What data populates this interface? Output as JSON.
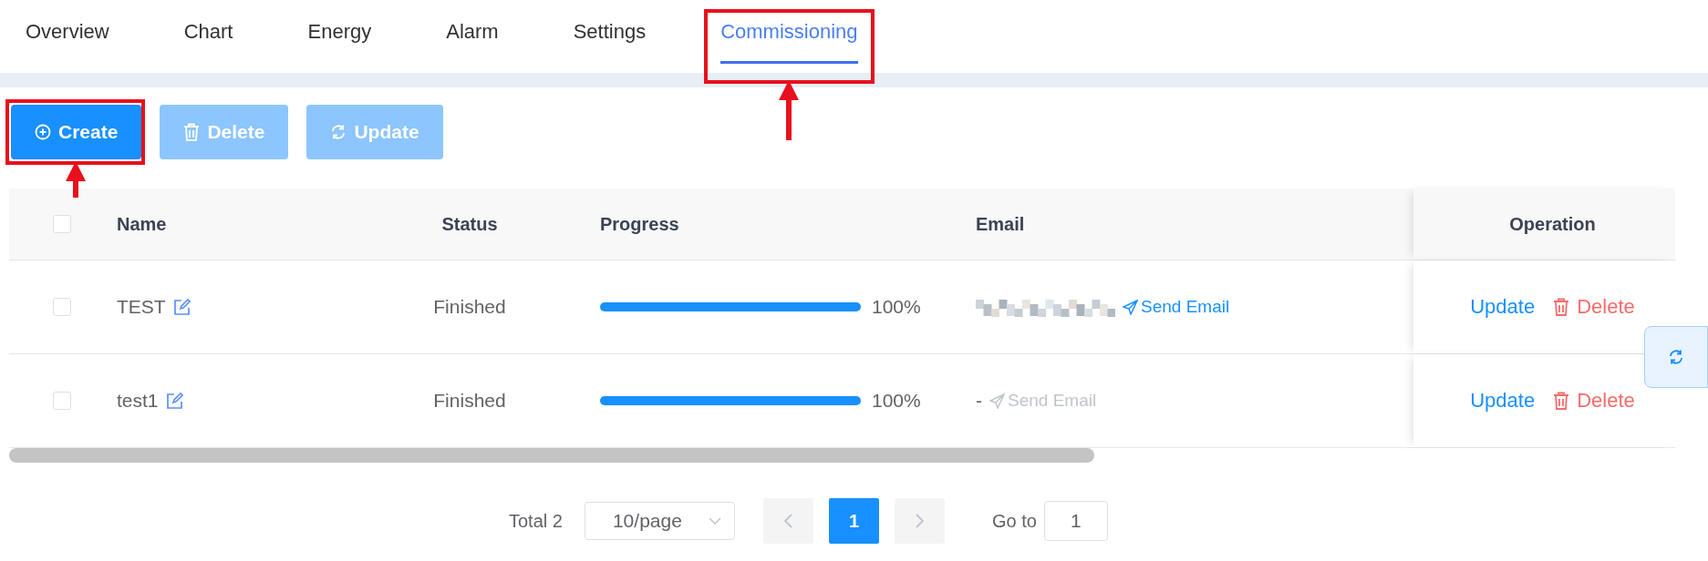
{
  "tabs": [
    {
      "label": "Overview",
      "selected": false,
      "highlighted": false
    },
    {
      "label": "Chart",
      "selected": false,
      "highlighted": false
    },
    {
      "label": "Energy",
      "selected": false,
      "highlighted": false
    },
    {
      "label": "Alarm",
      "selected": false,
      "highlighted": false
    },
    {
      "label": "Settings",
      "selected": false,
      "highlighted": false
    },
    {
      "label": "Commissioning",
      "selected": true,
      "highlighted": true
    }
  ],
  "toolbar": [
    {
      "kind": "create",
      "label": "Create",
      "disabled": false,
      "highlighted": true
    },
    {
      "kind": "delete",
      "label": "Delete",
      "disabled": true,
      "highlighted": false
    },
    {
      "kind": "update",
      "label": "Update",
      "disabled": true,
      "highlighted": false
    }
  ],
  "table": {
    "select_all": {
      "checked": false
    },
    "columns": [
      "Name",
      "Status",
      "Progress",
      "Email",
      "Operation"
    ],
    "rows": [
      {
        "checked": false,
        "name": "TEST",
        "status": "Finished",
        "level": 1,
        "reading": "100%",
        "email": {
          "kind": "redacted"
        },
        "send_email": {
          "label": "Send Email",
          "disabled": false
        },
        "actions": [
          {
            "kind": "update",
            "label": "Update"
          },
          {
            "kind": "delete",
            "label": "Delete"
          }
        ]
      },
      {
        "checked": false,
        "name": "test1",
        "status": "Finished",
        "level": 1,
        "reading": "100%",
        "email": {
          "kind": "text",
          "text": "-"
        },
        "send_email": {
          "label": "Send Email",
          "disabled": true
        },
        "actions": [
          {
            "kind": "update",
            "label": "Update"
          },
          {
            "kind": "delete",
            "label": "Delete"
          }
        ]
      }
    ]
  },
  "pagination": {
    "total": "Total 2",
    "page_size": "10/page",
    "pages": [
      {
        "label": "1",
        "selected": true
      }
    ],
    "goto_label": "Go to",
    "goto_value": "1"
  }
}
